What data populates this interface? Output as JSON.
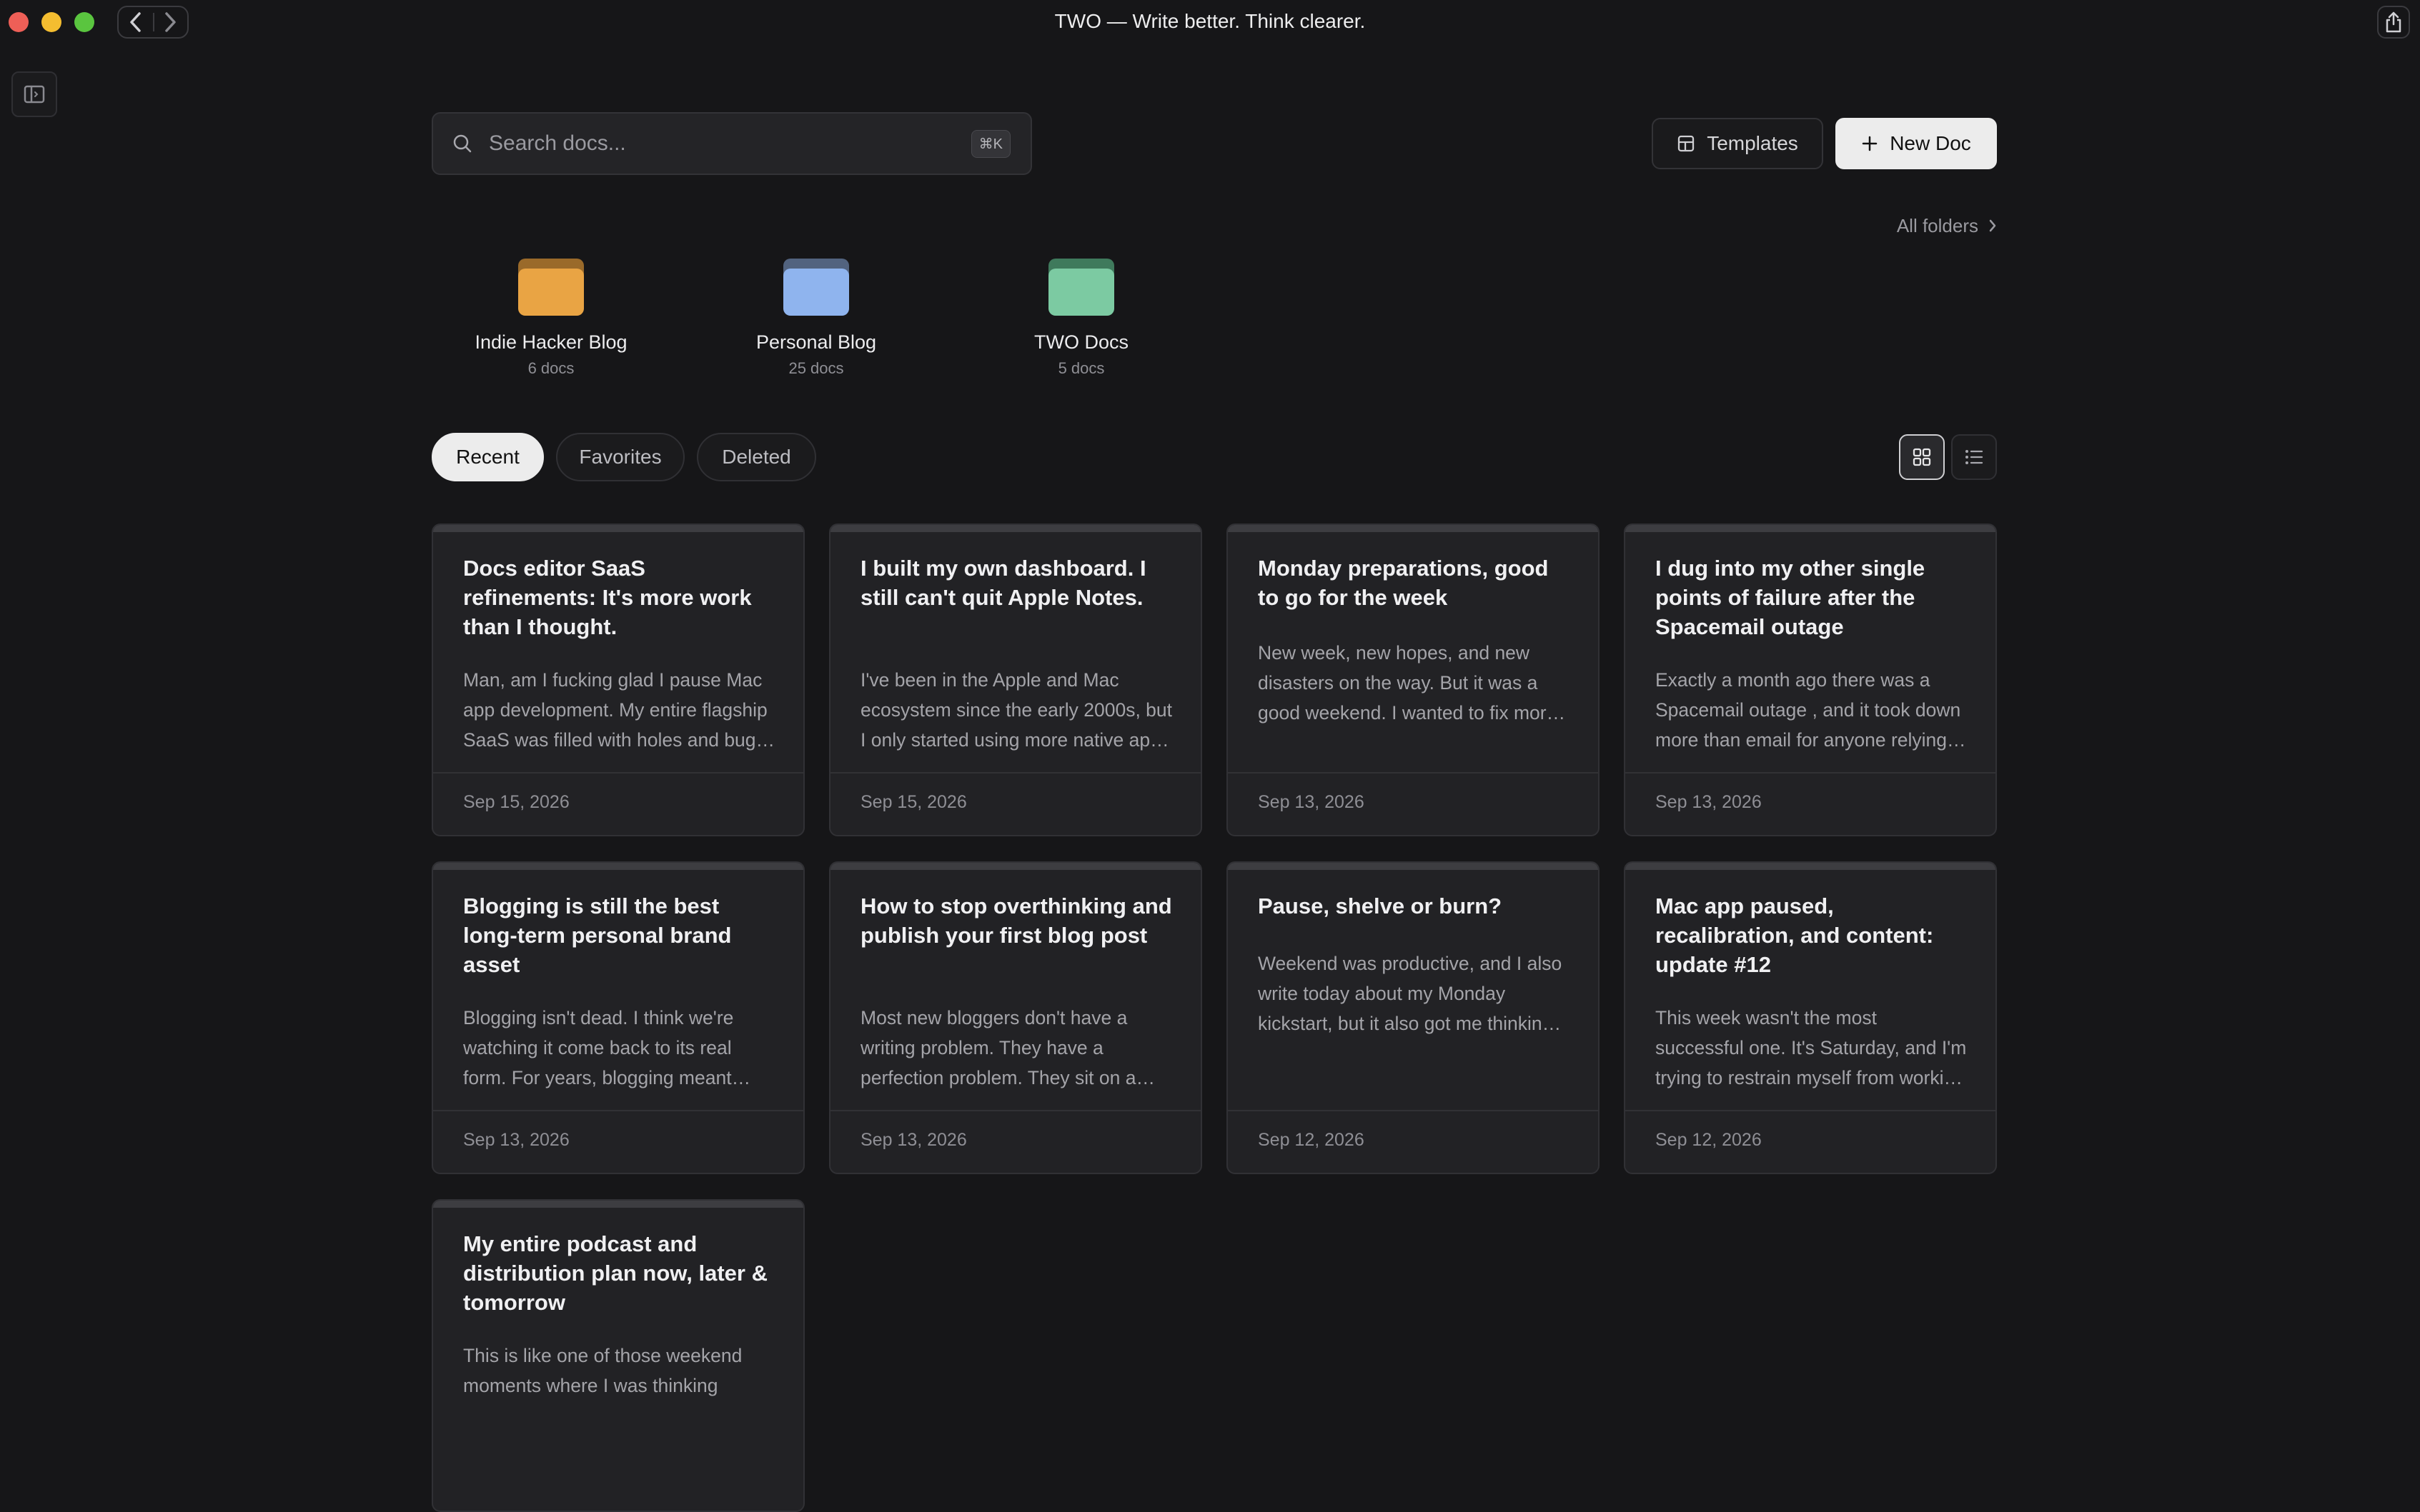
{
  "window": {
    "title": "TWO — Write better. Think clearer."
  },
  "search": {
    "placeholder": "Search docs...",
    "shortcut": "⌘K"
  },
  "toolbar": {
    "templates_label": "Templates",
    "new_doc_label": "New Doc"
  },
  "folders": {
    "all_label": "All folders",
    "items": [
      {
        "name": "Indie Hacker Blog",
        "count": "6 docs",
        "color": "#e9a444"
      },
      {
        "name": "Personal Blog",
        "count": "25 docs",
        "color": "#8fb4ee"
      },
      {
        "name": "TWO Docs",
        "count": "5 docs",
        "color": "#7ccaa2"
      }
    ]
  },
  "filters": {
    "tabs": [
      {
        "label": "Recent",
        "active": true
      },
      {
        "label": "Favorites",
        "active": false
      },
      {
        "label": "Deleted",
        "active": false
      }
    ],
    "view": "grid"
  },
  "docs": [
    {
      "title": "Docs editor SaaS refinements: It's more work than I thought.",
      "excerpt": "Man, am I fucking glad I pause Mac app development. My entire flagship SaaS was filled with holes and bugs I had to fix.",
      "date": "Sep 15, 2026"
    },
    {
      "title": "I built my own dashboard. I still can't quit Apple Notes.",
      "excerpt": "I've been in the Apple and Mac ecosystem since the early 2000s, but I only started using more native apps recently.",
      "date": "Sep 15, 2026"
    },
    {
      "title": "Monday preparations, good to go for the week",
      "excerpt": "New week, new hopes, and new disasters on the way. But it was a good weekend. I wanted to fix more bugs in my flagship SaaS , but I",
      "date": "Sep 13, 2026"
    },
    {
      "title": "I dug into my other single points of failure after the Spacemail outage",
      "excerpt": "Exactly a month ago there was a Spacemail outage , and it took down more than email for anyone relying on it.",
      "date": "Sep 13, 2026"
    },
    {
      "title": "Blogging is still the best long-term personal brand asset",
      "excerpt": "Blogging isn't dead. I think we're watching it come back to its real form. For years, blogging meant chasing traffic.",
      "date": "Sep 13, 2026"
    },
    {
      "title": "How to stop overthinking and publish your first blog post",
      "excerpt": "Most new bloggers don't have a writing problem. They have a perfection problem. They sit on a draft for weeks.",
      "date": "Sep 13, 2026"
    },
    {
      "title": "Pause, shelve or burn?",
      "excerpt": "Weekend was productive, and I also write today about my Monday kickstart, but it also got me thinking a bit about the things I've built and the ideas I am still",
      "date": "Sep 12, 2026"
    },
    {
      "title": "Mac app paused, recalibration, and content: update #12",
      "excerpt": "This week wasn't the most successful one. It's Saturday, and I'm trying to restrain myself from working on anything.",
      "date": "Sep 12, 2026"
    },
    {
      "title": "My entire podcast and distribution plan now, later & tomorrow",
      "excerpt": "This is like one of those weekend moments where I was thinking",
      "date": ""
    }
  ]
}
